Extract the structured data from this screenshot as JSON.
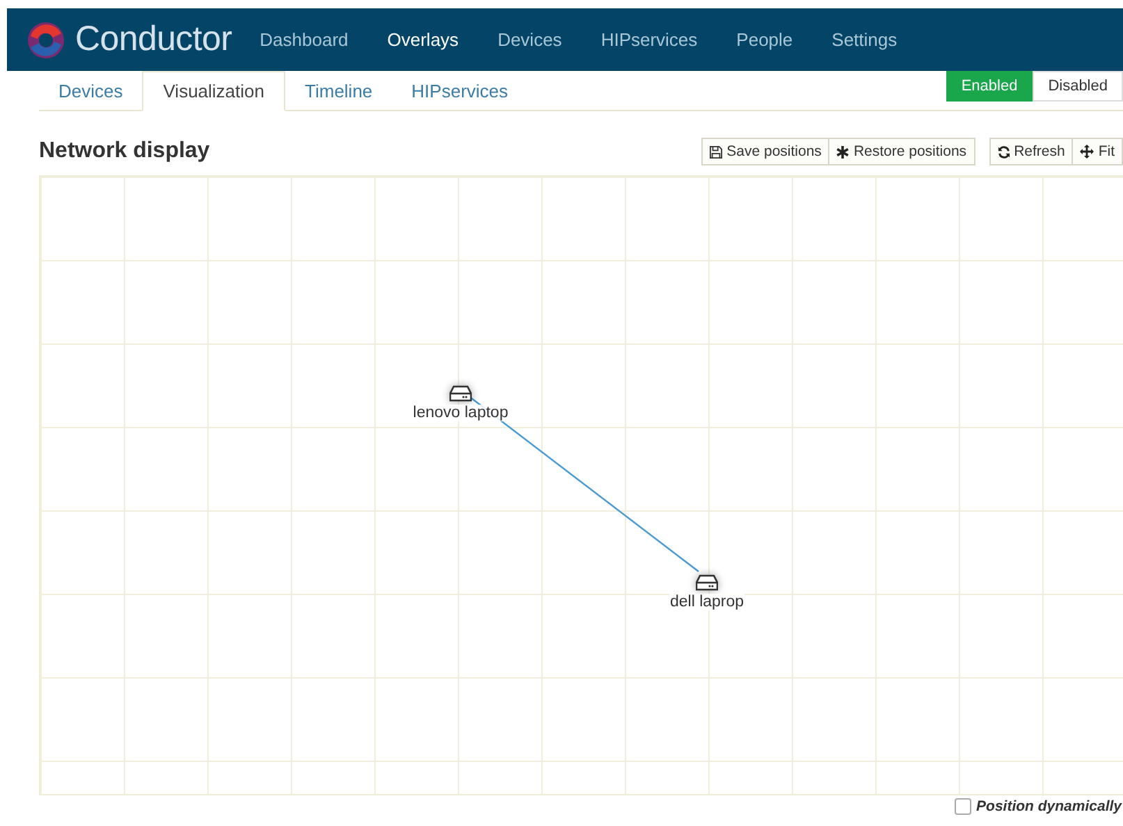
{
  "app": {
    "title": "Conductor"
  },
  "nav": [
    {
      "label": "Dashboard",
      "selected": false
    },
    {
      "label": "Overlays",
      "selected": true
    },
    {
      "label": "Devices",
      "selected": false
    },
    {
      "label": "HIPservices",
      "selected": false
    },
    {
      "label": "People",
      "selected": false
    },
    {
      "label": "Settings",
      "selected": false
    }
  ],
  "tabs": [
    {
      "label": "Devices",
      "selected": false
    },
    {
      "label": "Visualization",
      "selected": true
    },
    {
      "label": "Timeline",
      "selected": false
    },
    {
      "label": "HIPservices",
      "selected": false
    }
  ],
  "toggle": [
    {
      "label": "Enabled",
      "selected": true
    },
    {
      "label": "Disabled",
      "selected": false
    }
  ],
  "panel": {
    "title": "Network display"
  },
  "toolbar": [
    {
      "label": "Save positions"
    },
    {
      "label": "Restore positions"
    },
    {
      "label": "Refresh"
    },
    {
      "label": "Fit"
    }
  ],
  "nodes": [
    {
      "label": "lenovo laptop"
    },
    {
      "label": "dell laprop"
    }
  ],
  "position_dynamically": {
    "label": "Position dynamically",
    "checked": false
  }
}
